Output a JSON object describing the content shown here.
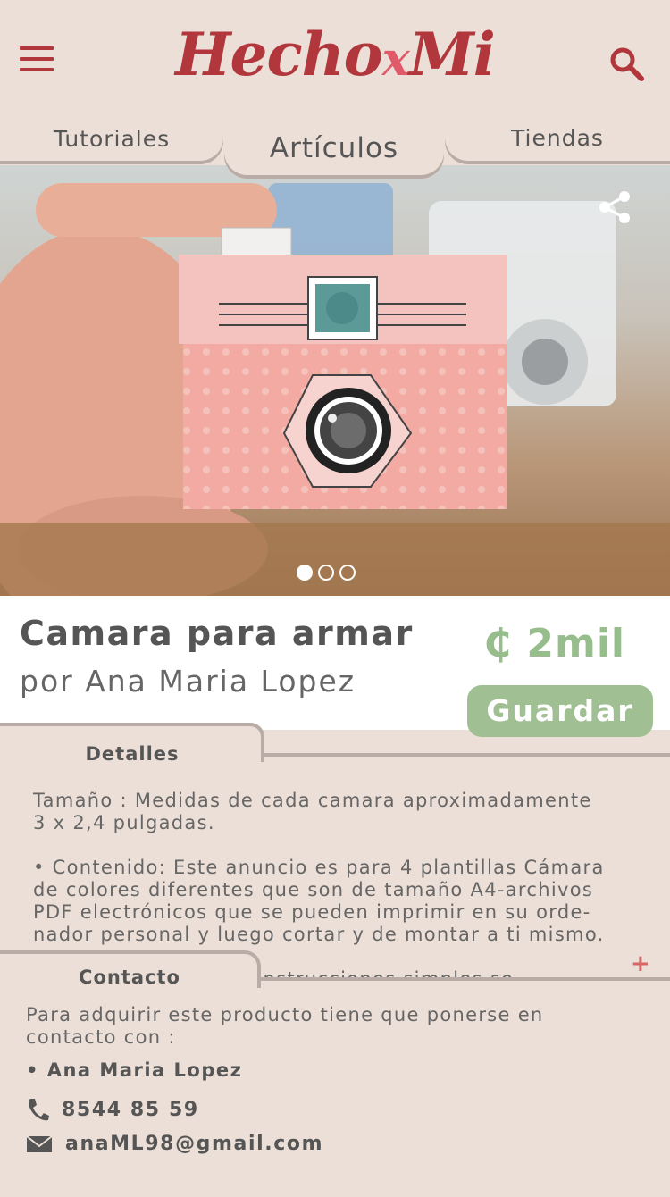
{
  "app": {
    "logo_main": "Hecho",
    "logo_x": "x",
    "logo_end": "Mi"
  },
  "tabs": {
    "left": "Tutoriales",
    "active": "Artículos",
    "right": "Tiendas"
  },
  "carousel": {
    "slide_count": 3,
    "active_index": 0
  },
  "product": {
    "title": "Camara para armar",
    "author": "por Ana Maria Lopez",
    "price": "₵ 2mil",
    "save_label": "Guardar"
  },
  "details": {
    "label": "Detalles",
    "paragraphs": [
      "Tamaño : Medidas de cada camara aproximadamente\n3 x 2,4 pulgadas.",
      "• Contenido: Este anuncio es para 4 plantillas Cámara\nde colores diferentes que son de tamaño A4-archivos\nPDF electrónicos que se pueden imprimir en su orde-\nnador personal y luego cortar y de montar a ti mismo.",
      "Instrucciones simples se"
    ],
    "expand_symbol": "+"
  },
  "contact": {
    "label": "Contacto",
    "intro": "Para adquirir este producto tiene que ponerse en contacto con :",
    "name": "• Ana Maria Lopez",
    "phone": "8544 85 59",
    "email": "anaML98@gmail.com"
  },
  "colors": {
    "brand": "#b1373c",
    "background": "#ecdfd7",
    "accent_green": "#a0bf93",
    "price_green": "#98bd8c",
    "plus_red": "#d96466"
  },
  "icons": [
    "menu-icon",
    "search-icon",
    "share-icon",
    "phone-icon",
    "mail-icon",
    "plus-icon"
  ]
}
